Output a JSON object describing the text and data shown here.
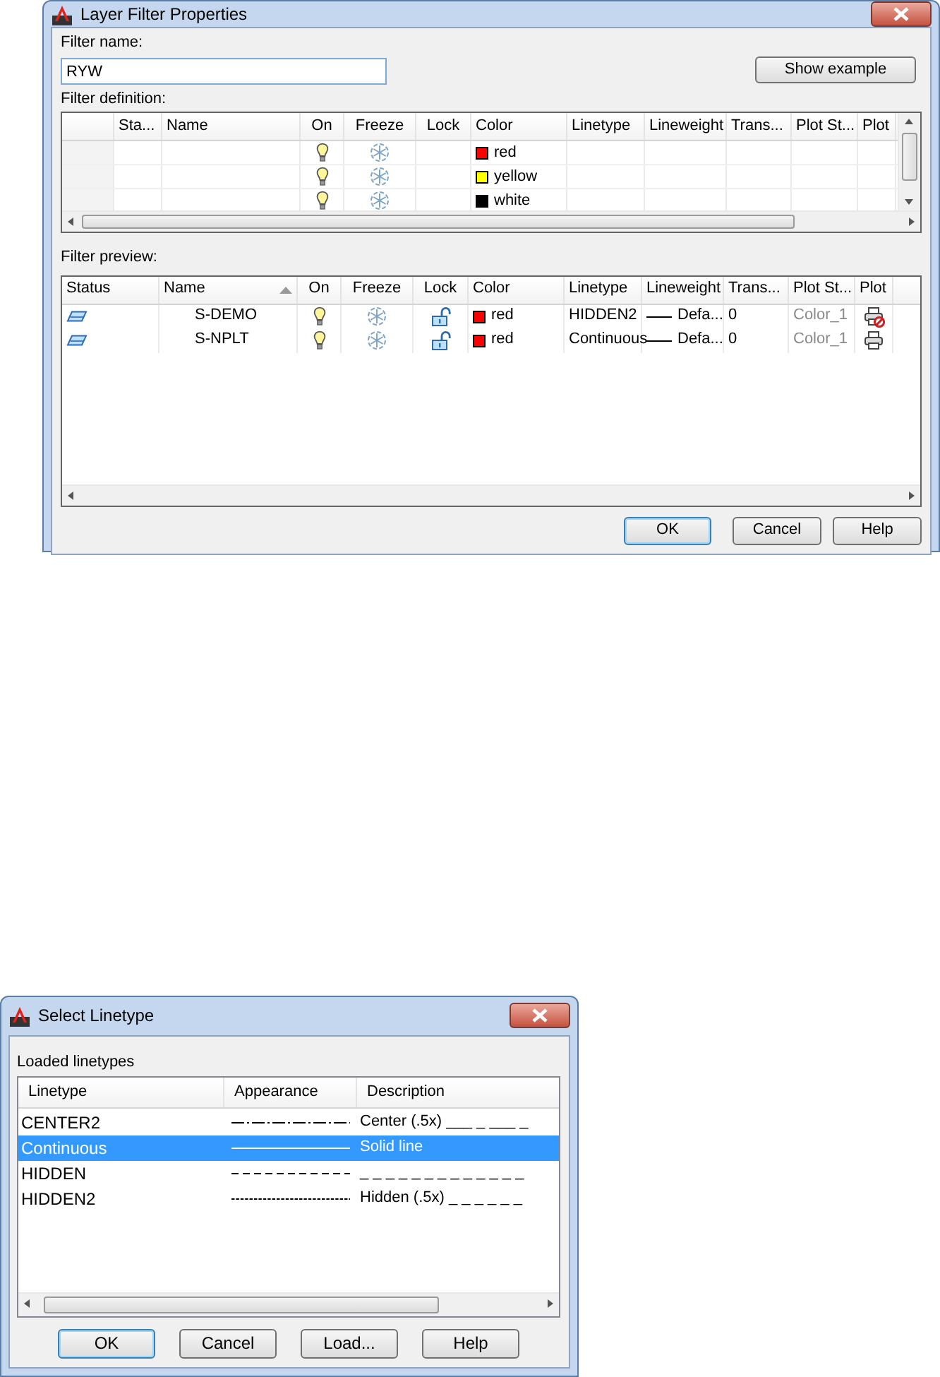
{
  "layer_filter_dialog": {
    "title": "Layer Filter Properties",
    "filter_name_label": "Filter name:",
    "filter_name_value": "RYW",
    "show_example_button": "Show example",
    "definition_label": "Filter definition:",
    "definition_columns": [
      "Sta...",
      "Name",
      "On",
      "Freeze",
      "Lock",
      "Color",
      "Linetype",
      "Lineweight",
      "Trans...",
      "Plot St...",
      "Plot"
    ],
    "definition_rows": [
      {
        "on": true,
        "frozen": false,
        "color": "#ff0000",
        "color_name": "red"
      },
      {
        "on": true,
        "frozen": false,
        "color": "#ffff00",
        "color_name": "yellow"
      },
      {
        "on": true,
        "frozen": false,
        "color": "#000000",
        "color_name": "white"
      }
    ],
    "preview_label": "Filter preview:",
    "preview_columns": [
      "Status",
      "Name",
      "On",
      "Freeze",
      "Lock",
      "Color",
      "Linetype",
      "Lineweight",
      "Trans...",
      "Plot St...",
      "Plot"
    ],
    "preview_rows": [
      {
        "name": "S-DEMO",
        "on": true,
        "frozen": false,
        "locked": false,
        "color": "#ff0000",
        "color_name": "red",
        "linetype": "HIDDEN2",
        "lineweight": "Defa...",
        "transparency": "0",
        "plot_style": "Color_1",
        "plot": false
      },
      {
        "name": "S-NPLT",
        "on": true,
        "frozen": false,
        "locked": false,
        "color": "#ff0000",
        "color_name": "red",
        "linetype": "Continuous",
        "lineweight": "Defa...",
        "transparency": "0",
        "plot_style": "Color_1",
        "plot": true
      }
    ],
    "buttons": [
      {
        "label": "OK",
        "default": true
      },
      {
        "label": "Cancel",
        "default": false
      },
      {
        "label": "Help",
        "default": false
      }
    ]
  },
  "linetype_dialog": {
    "title": "Select Linetype",
    "list_label": "Loaded linetypes",
    "columns": [
      "Linetype",
      "Appearance",
      "Description"
    ],
    "rows": [
      {
        "linetype": "CENTER2",
        "kind": "center",
        "description": "Center (.5x) ___ _ ___ _",
        "selected": false
      },
      {
        "linetype": "Continuous",
        "kind": "continuous",
        "description": "Solid line",
        "selected": true
      },
      {
        "linetype": "HIDDEN",
        "kind": "hidden",
        "description": "_ _ _ _ _ _ _ _ _ _ _ _ _",
        "selected": false
      },
      {
        "linetype": "HIDDEN2",
        "kind": "hidden2",
        "description": "Hidden (.5x) _ _ _ _ _ _",
        "selected": false
      }
    ],
    "buttons": [
      {
        "label": "OK",
        "default": true
      },
      {
        "label": "Cancel",
        "default": false
      },
      {
        "label": "Load...",
        "default": false
      },
      {
        "label": "Help",
        "default": false
      }
    ]
  }
}
